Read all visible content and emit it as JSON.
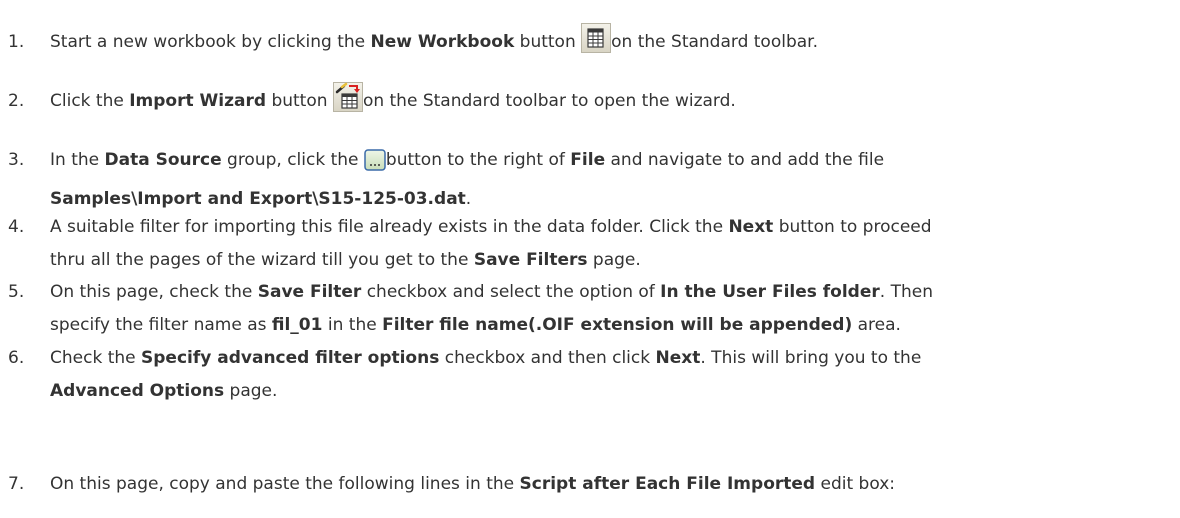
{
  "steps": [
    {
      "number": "1.",
      "t1": "Start a new workbook by clicking the ",
      "b1": "New Workbook",
      "t2": " button ",
      "icon": "new-workbook-icon",
      "t3": "on the Standard toolbar."
    },
    {
      "number": "2.",
      "t1": "Click the ",
      "b1": "Import Wizard",
      "t2": " button ",
      "icon": "import-wizard-icon",
      "t3": "on the Standard toolbar to open the wizard."
    },
    {
      "number": "3.",
      "t1": "In the ",
      "b1": "Data Source",
      "t2": " group, click the ",
      "icon": "browse-button-icon",
      "t3": "button to the right of ",
      "b2": "File",
      "t4": " and navigate to and add the file",
      "b3": "Samples\\Import and Export\\S15-125-03.dat",
      "t5": "."
    },
    {
      "number": "4.",
      "t1": "A suitable filter for importing this file already exists in the data folder. Click the ",
      "b1": "Next",
      "t2": " button to proceed",
      "t3": "thru all the pages of the wizard till you get to the ",
      "b2": "Save Filters",
      "t4": " page."
    },
    {
      "number": "5.",
      "t1": "On this page, check the ",
      "b1": "Save Filter",
      "t2": " checkbox and select the option of ",
      "b2": "In the User Files folder",
      "t3": ". Then",
      "t4": "specify the filter name as ",
      "b3": "fil_01",
      "t5": " in the ",
      "b4": "Filter file name(.OIF extension will be appended)",
      "t6": " area."
    },
    {
      "number": "6.",
      "t1": "Check the ",
      "b1": "Specify advanced filter options",
      "t2": " checkbox and then click ",
      "b2": "Next",
      "t3": ". This will bring you to the",
      "b3": "Advanced Options",
      "t4": " page."
    },
    {
      "number": "7.",
      "t1": "On this page, copy and paste the following lines in the ",
      "b1": "Script after Each File Imported",
      "t2": " edit box:"
    }
  ]
}
